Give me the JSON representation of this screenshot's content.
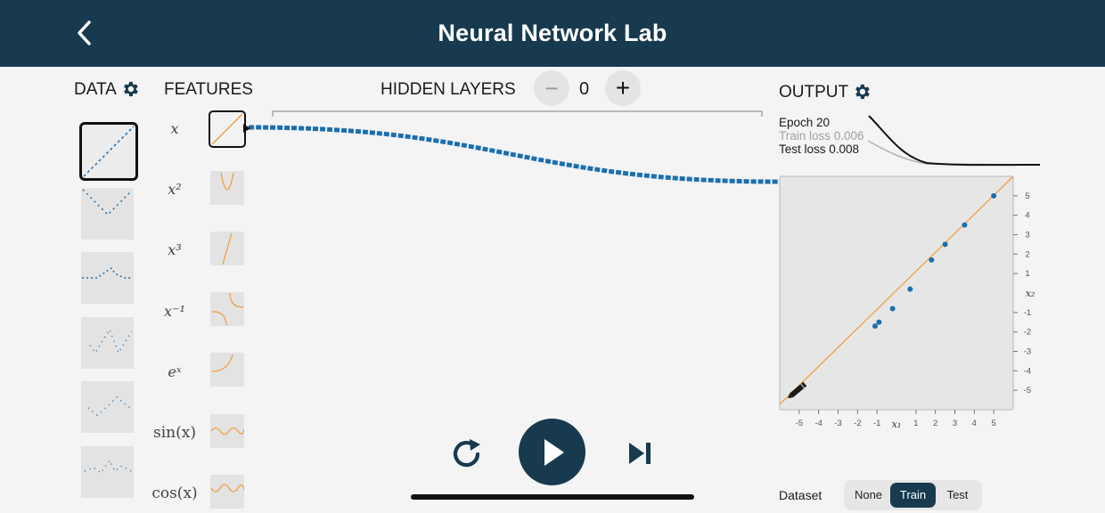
{
  "header": {
    "title": "Neural Network Lab",
    "back_icon": "chevron-left-icon"
  },
  "data_panel": {
    "label": "DATA",
    "settings_icon": "gear-icon",
    "datasets": [
      "linear",
      "v-shape",
      "step",
      "zigzag",
      "wave",
      "noisy"
    ],
    "selected_index": 0
  },
  "features_panel": {
    "label": "FEATURES",
    "features": [
      {
        "name": "x",
        "label": "x",
        "selected": true
      },
      {
        "name": "x_squared",
        "label": "x²",
        "selected": false
      },
      {
        "name": "x_cubed",
        "label": "x³",
        "selected": false
      },
      {
        "name": "x_inverse",
        "label": "x⁻¹",
        "selected": false
      },
      {
        "name": "exp_x",
        "label": "eˣ",
        "selected": false
      },
      {
        "name": "sin_x",
        "label": "sin(x)",
        "selected": false
      },
      {
        "name": "cos_x",
        "label": "cos(x)",
        "selected": false
      }
    ]
  },
  "hidden_layers": {
    "label": "HIDDEN LAYERS",
    "count": "0",
    "minus": "−",
    "plus": "+"
  },
  "output_panel": {
    "label": "OUTPUT",
    "settings_icon": "gear-icon",
    "epoch": "Epoch 20",
    "train_loss": "Train loss 0.006",
    "test_loss": "Test loss 0.008"
  },
  "plot": {
    "x_ticks": [
      "-5",
      "-4",
      "-3",
      "-2",
      "-1",
      "1",
      "2",
      "3",
      "4",
      "5"
    ],
    "y_ticks": [
      "5",
      "4",
      "3",
      "2",
      "1",
      "-1",
      "-2",
      "-3",
      "-4",
      "-5"
    ],
    "x_axis_label": "x₁",
    "y_axis_label": "x₂",
    "points": [
      [
        -1.1,
        -1.7
      ],
      [
        -0.9,
        -1.5
      ],
      [
        -0.2,
        -0.8
      ],
      [
        0.7,
        0.2
      ],
      [
        1.8,
        1.7
      ],
      [
        2.5,
        2.5
      ],
      [
        3.5,
        3.5
      ],
      [
        5.0,
        5.0
      ]
    ],
    "line_color": "#f0a040",
    "point_color": "#1a6fb0"
  },
  "controls": {
    "reset_icon": "reset-icon",
    "play_icon": "play-icon",
    "step_icon": "step-forward-icon"
  },
  "dataset_toggle": {
    "label": "Dataset",
    "options": [
      "None",
      "Train",
      "Test"
    ],
    "active": "Train"
  },
  "colors": {
    "header": "#173a4f",
    "accent": "#1a6fb0",
    "orange": "#f0a040"
  }
}
